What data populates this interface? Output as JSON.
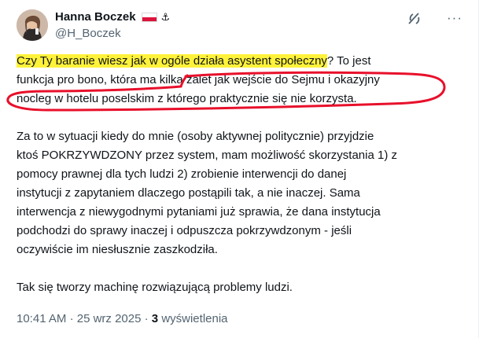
{
  "author": {
    "name": "Hanna Boczek",
    "badges": [
      "poland-flag-icon",
      "anchor-icon"
    ],
    "anchor_glyph": "⚓",
    "handle": "@H_Boczek"
  },
  "post": {
    "paragraph1": {
      "line1_highlight": "Czy Ty baranie wiesz jak w ogóle działa asystent społeczny",
      "line1_rest": "? To jest",
      "line2": "funkcja pro bono, która ma kilka zalet jak wejście do Sejmu i okazyjny",
      "line3": "nocleg w hotelu poselskim z którego praktycznie się nie korzysta."
    },
    "paragraph2": [
      "Za to w sytuacji kiedy do mnie (osoby aktywnej politycznie) przyjdzie",
      "ktoś POKRZYWDZONY przez system, mam możliwość skorzystania 1) z",
      "pomocy prawnej dla tych ludzi 2) zrobienie interwencji do danej",
      "instytucji z zapytaniem dlaczego postąpili tak, a nie inaczej. Sama",
      "interwencja z niewygodnymi pytaniami już sprawia, że dana instytucja",
      "podchodzi do sprawy inaczej i odpuszcza pokrzywdzonym - jeśli",
      "oczywiście im niesłusznie zaszkodziła."
    ],
    "paragraph3": "Tak się tworzy machinę rozwiązującą problemy ludzi."
  },
  "meta": {
    "time": "10:41 AM",
    "separator": "·",
    "date": "25 wrz 2025",
    "views_count": "3",
    "views_label": "wyświetlenia"
  },
  "annotations": {
    "highlight_color": "#fff23a",
    "circle_color": "#e8102b"
  },
  "icons": {
    "grok": "grok-icon",
    "more": "more-options-icon",
    "more_glyph": "···"
  }
}
